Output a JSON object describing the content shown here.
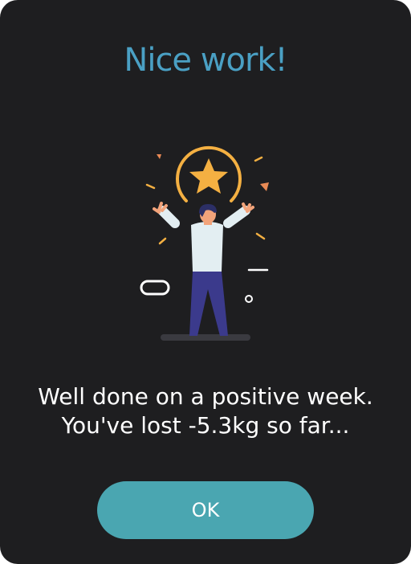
{
  "dialog": {
    "title": "Nice work!",
    "message": "Well done on a positive week. You've lost -5.3kg so far...",
    "ok_label": "OK"
  },
  "illustration": {
    "icon": "celebrating-person-star-illustration",
    "colors": {
      "star": "#f4b042",
      "ring": "#f4b042",
      "shirt": "#e3eef2",
      "pants": "#3b3a8c",
      "hair": "#2c2f66",
      "skin": "#f2a37a",
      "confetti_orange": "#e98a55",
      "confetti_yellow": "#f4b042",
      "ground": "#3a3a40"
    }
  }
}
